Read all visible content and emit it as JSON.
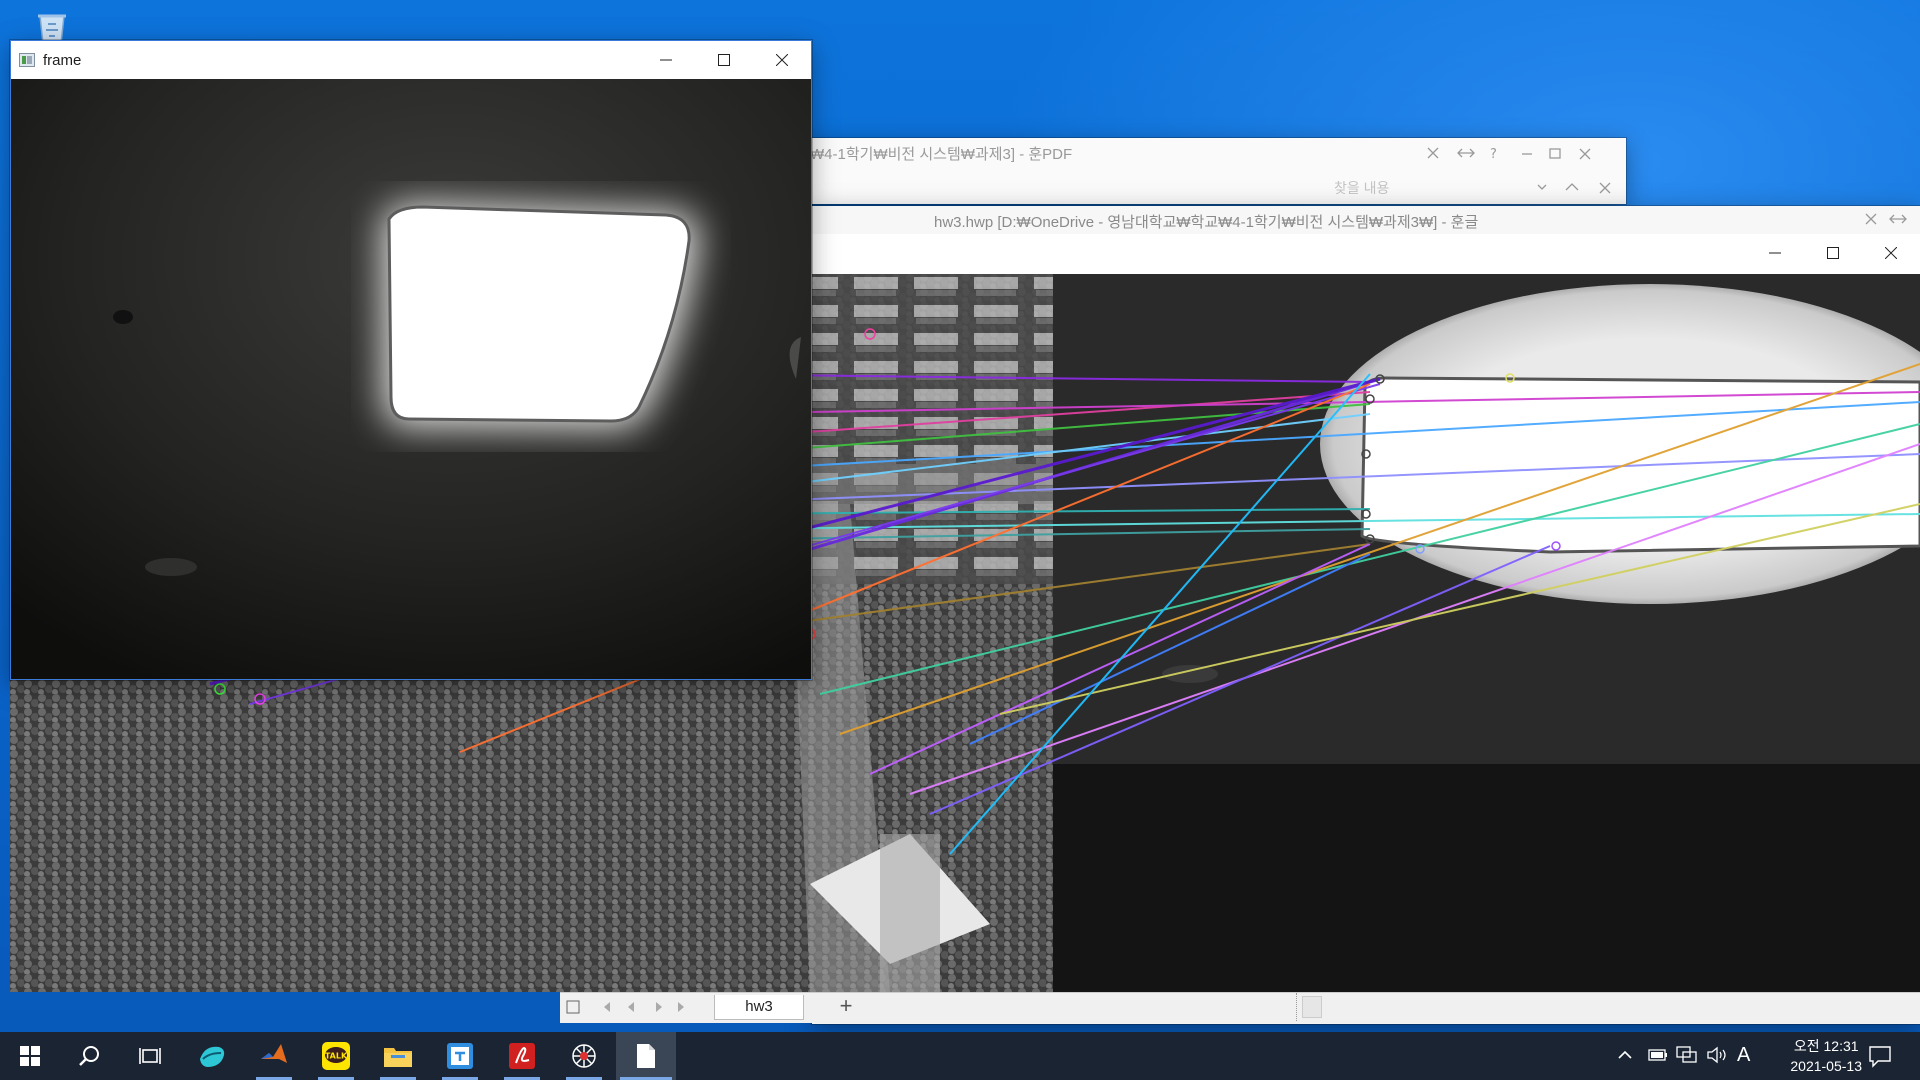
{
  "desktop": {
    "icons": [
      {
        "name": "Recycle Bin"
      }
    ]
  },
  "frame_window": {
    "title": "frame"
  },
  "pdf_window": {
    "title": "₩4-1학기₩비전 시스템₩과제3] - 훈PDF",
    "search_placeholder": "찾을 내용"
  },
  "hwp_window": {
    "title": "hw3.hwp [D:₩OneDrive - 영남대학교₩학교₩4-1학기₩비전 시스템₩과제3₩] - 훈글",
    "sheet_tab": "hw3",
    "add_tab": "+"
  },
  "taskbar": {
    "apps": [
      {
        "name": "start"
      },
      {
        "name": "search"
      },
      {
        "name": "task-view"
      },
      {
        "name": "whale-browser"
      },
      {
        "name": "matlab"
      },
      {
        "name": "kakaotalk",
        "label": "TALK"
      },
      {
        "name": "file-explorer"
      },
      {
        "name": "hancom-docs"
      },
      {
        "name": "acrobat"
      },
      {
        "name": "spider-app"
      },
      {
        "name": "document"
      }
    ],
    "tray": {
      "ime": "A"
    },
    "clock": {
      "time": "오전 12:31",
      "date": "2021-05-13"
    }
  },
  "colors": {
    "desktop": "#0a66cc",
    "taskbar": "#1b2433",
    "accent": "#3b7ad8"
  }
}
